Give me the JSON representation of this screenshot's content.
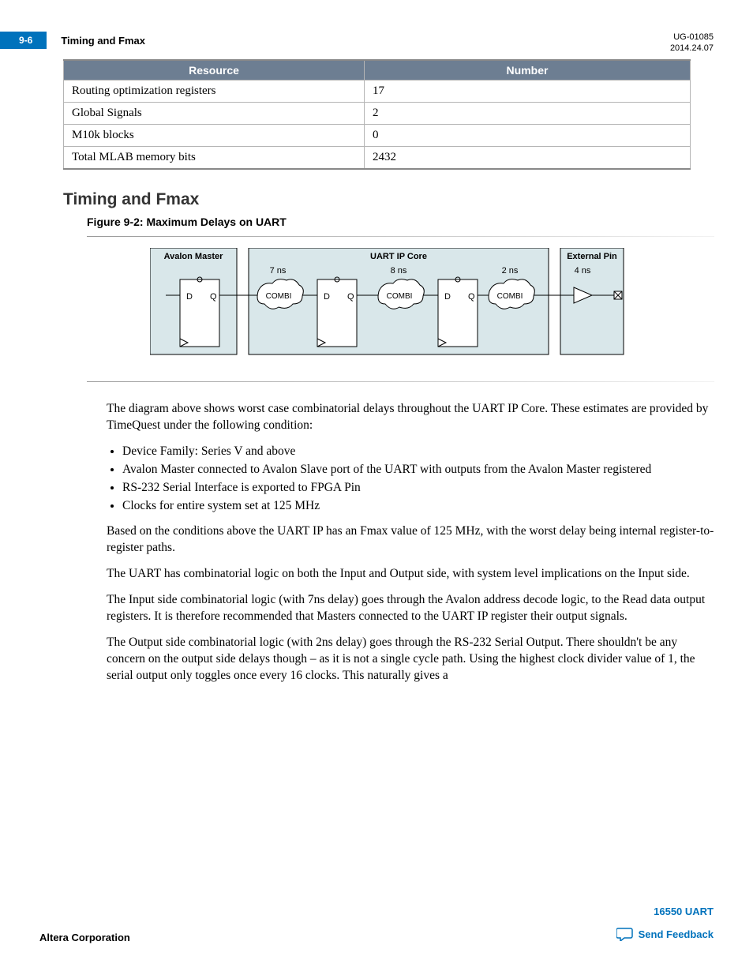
{
  "header": {
    "page_num": "9-6",
    "title": "Timing and Fmax",
    "doc_id": "UG-01085",
    "doc_date": "2014.24.07"
  },
  "table": {
    "headers": [
      "Resource",
      "Number"
    ],
    "rows": [
      [
        "Routing optimization registers",
        "17"
      ],
      [
        "Global Signals",
        "2"
      ],
      [
        "M10k blocks",
        "0"
      ],
      [
        "Total MLAB memory bits",
        "2432"
      ]
    ]
  },
  "section_heading": "Timing and Fmax",
  "figure_title": "Figure 9-2: Maximum Delays on UART",
  "diagram": {
    "box_avalon": "Avalon Master",
    "box_uart": "UART IP Core",
    "box_ext": "External Pin",
    "delay1": "7 ns",
    "delay2": "8 ns",
    "delay3": "2 ns",
    "delay4": "4 ns",
    "d": "D",
    "q": "Q",
    "combi": "COMBI"
  },
  "paras": {
    "p1": "The diagram above shows worst case combinatorial delays throughout the UART IP Core. These estimates are provided by TimeQuest under the following condition:",
    "p2": "Based on the conditions above the UART IP has an Fmax value of 125 MHz, with the worst delay being internal register-to-register paths.",
    "p3": "The UART has combinatorial logic on both the Input and Output side, with system level implications on the Input side.",
    "p4": "The Input side combinatorial logic (with 7ns delay) goes through the Avalon address decode logic, to the Read data output registers. It is therefore recommended that Masters connected to the UART IP register their output signals.",
    "p5": "The Output side combinatorial logic (with 2ns delay) goes through the RS-232 Serial Output. There shouldn't be any concern on the output side delays though – as it is not a single cycle path. Using the highest clock divider value of 1, the serial output only toggles once every 16 clocks. This naturally gives a"
  },
  "bullets": [
    "Device Family: Series V and above",
    "Avalon Master connected to Avalon Slave port of the UART with outputs from the Avalon Master registered",
    "RS-232 Serial Interface is exported to FPGA Pin",
    "Clocks for entire system set at 125 MHz"
  ],
  "footer": {
    "left": "Altera Corporation",
    "product": "16550 UART",
    "feedback": "Send Feedback"
  }
}
